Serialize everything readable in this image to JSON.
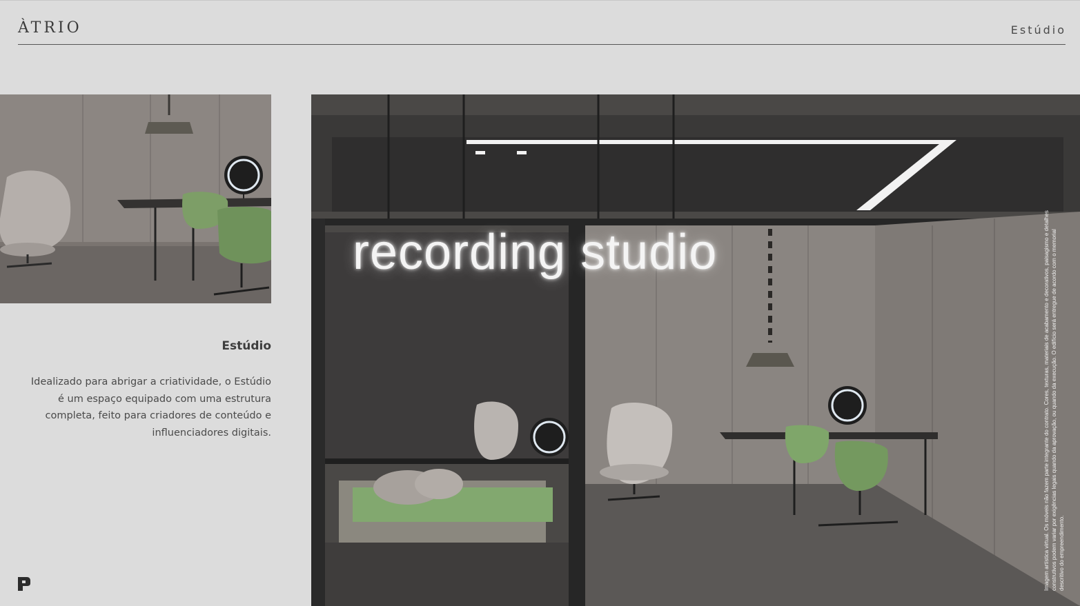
{
  "header": {
    "brand": "ÀTRIO",
    "section": "Estúdio"
  },
  "content": {
    "title": "Estúdio",
    "body": "Idealizado para abrigar a criatividade, o Estúdio é um espaço equipado com uma estrutura completa, feito para criadores de conteúdo e influenciadores digitais."
  },
  "main_image": {
    "neon_sign": "recording studio",
    "disclaimer": "Imagem artística virtual. Os móveis não fazem parte integrante do contrato. Cores, texturas, materiais de acabamento e decorativos, paisagismo e detalhes construtivos podem variar por exigências legais quando da aprovação, ou quando da execução. O edifício será entregue de acordo com o memorial descritivo do empreendimento."
  },
  "footer": {
    "logo_icon": "brand-p-logo-icon"
  }
}
